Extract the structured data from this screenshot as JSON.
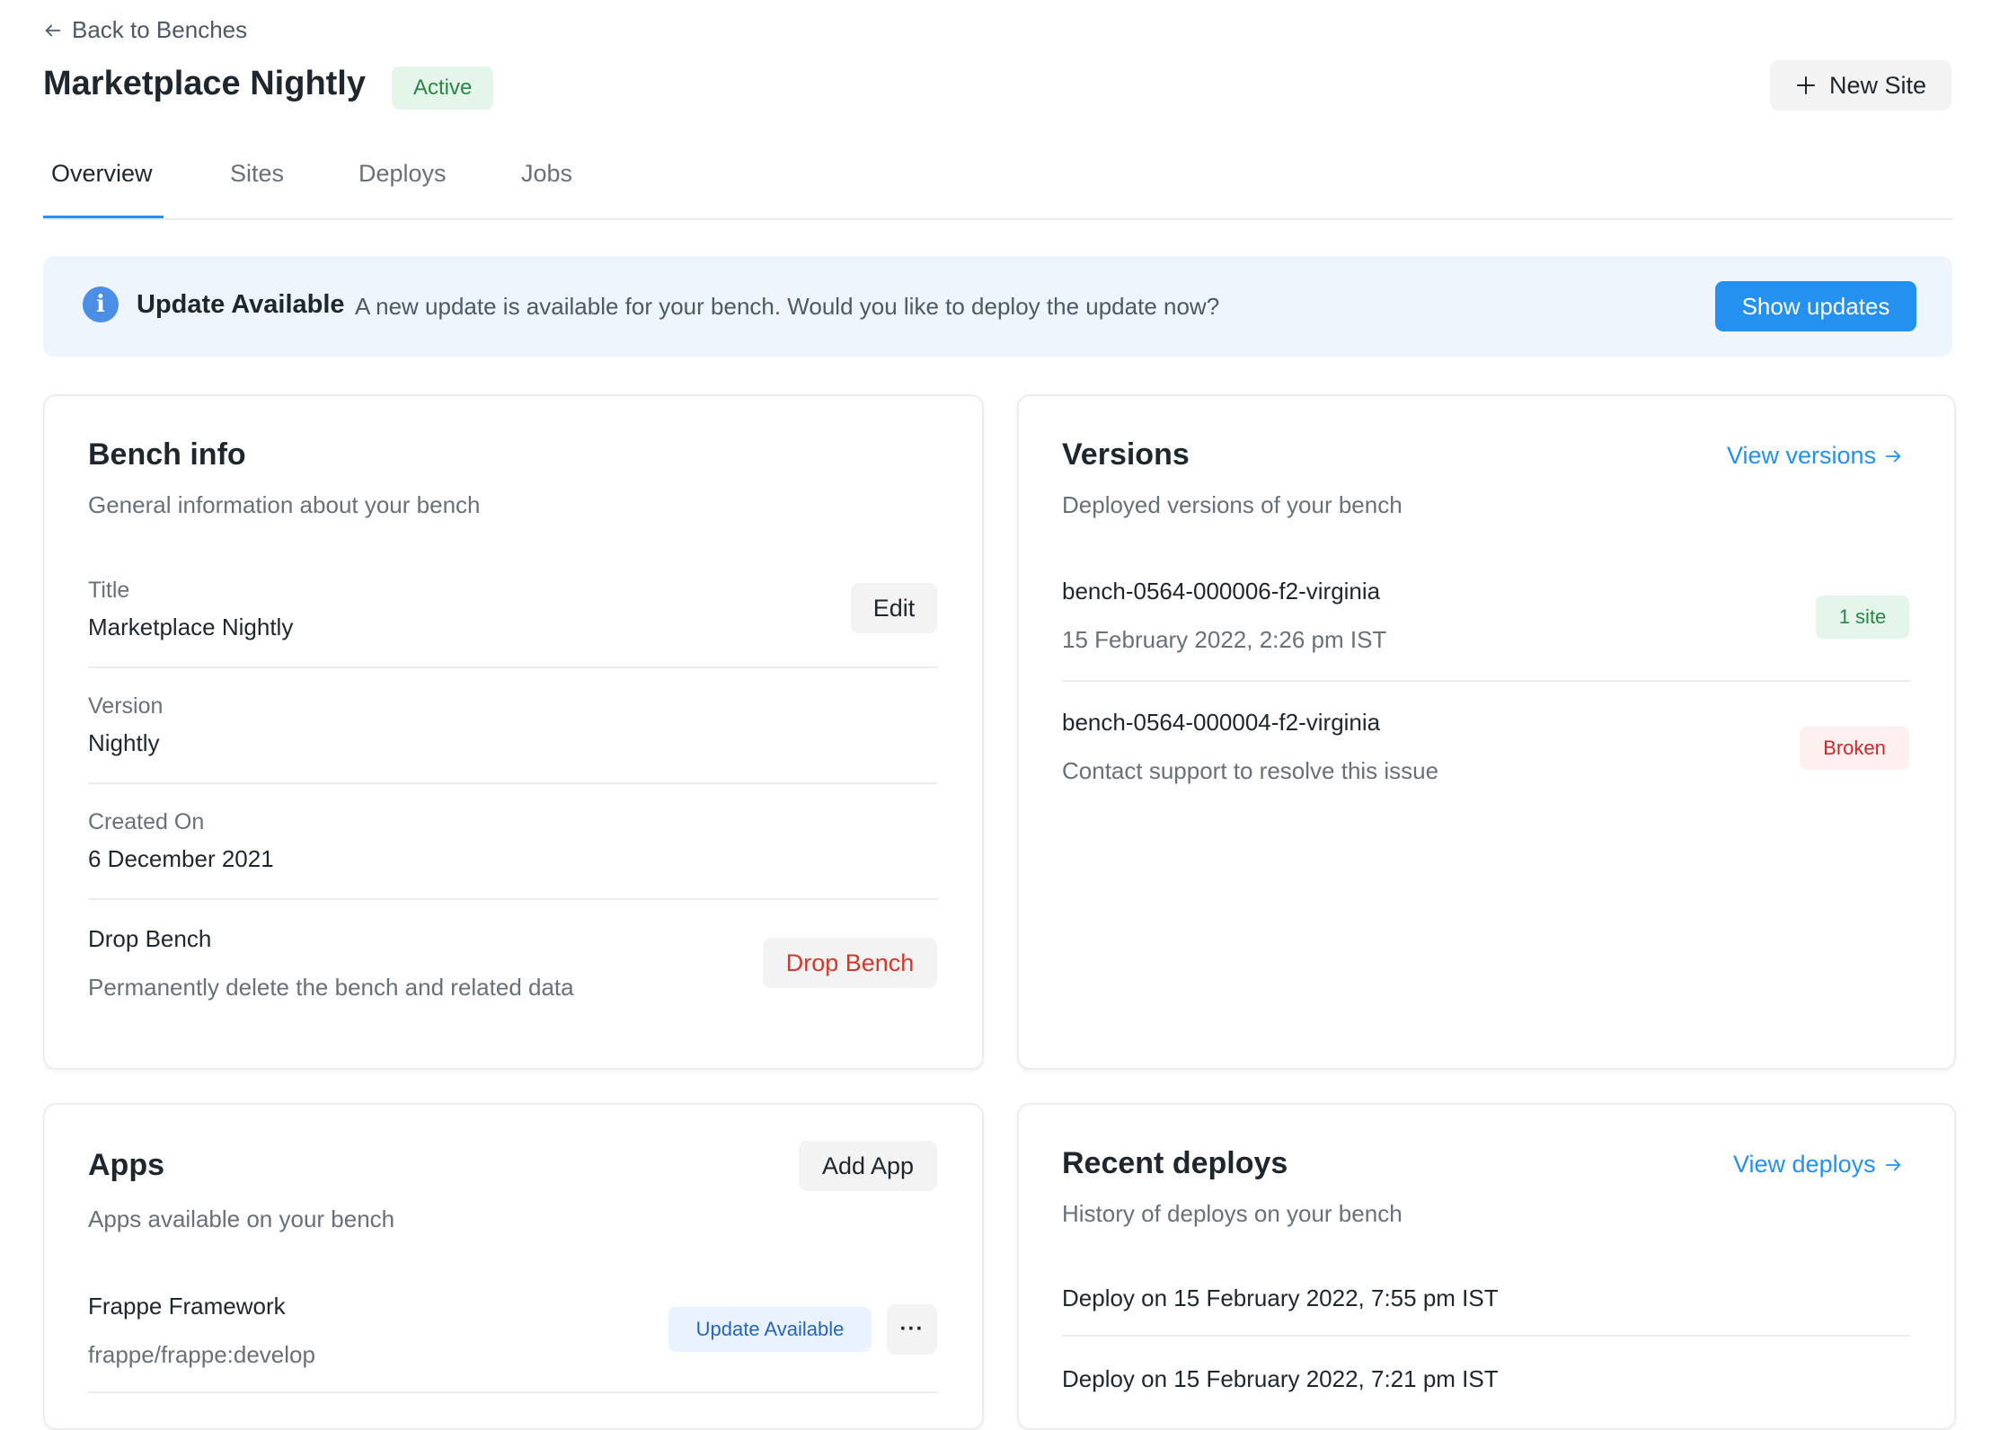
{
  "header": {
    "back_label": "Back to Benches",
    "title": "Marketplace Nightly",
    "status": "Active",
    "new_site_label": "New Site"
  },
  "tabs": [
    {
      "label": "Overview",
      "active": true
    },
    {
      "label": "Sites"
    },
    {
      "label": "Deploys"
    },
    {
      "label": "Jobs"
    }
  ],
  "banner": {
    "title": "Update Available",
    "message": "A new update is available for your bench. Would you like to deploy the update now?",
    "button_label": "Show updates"
  },
  "bench_info": {
    "title": "Bench info",
    "subtitle": "General information about your bench",
    "fields": [
      {
        "label": "Title",
        "value": "Marketplace Nightly"
      },
      {
        "label": "Version",
        "value": "Nightly"
      },
      {
        "label": "Created On",
        "value": "6 December 2021"
      }
    ],
    "edit_label": "Edit",
    "drop": {
      "title": "Drop Bench",
      "description": "Permanently delete the bench and related data",
      "button_label": "Drop Bench"
    }
  },
  "versions": {
    "title": "Versions",
    "subtitle": "Deployed versions of your bench",
    "link_label": "View versions",
    "items": [
      {
        "name": "bench-0564-000006-f2-virginia",
        "detail": "15 February 2022, 2:26 pm IST",
        "badge": "1 site"
      },
      {
        "name": "bench-0564-000004-f2-virginia",
        "detail": "Contact support to resolve this issue",
        "badge": "Broken"
      }
    ]
  },
  "apps": {
    "title": "Apps",
    "subtitle": "Apps available on your bench",
    "add_label": "Add App",
    "items": [
      {
        "name": "Frappe Framework",
        "repo": "frappe/frappe:develop",
        "badge": "Update Available",
        "menu": "···"
      }
    ]
  },
  "recent_deploys": {
    "title": "Recent deploys",
    "subtitle": "History of deploys on your bench",
    "link_label": "View deploys",
    "items": [
      "Deploy on 15 February 2022, 7:55 pm IST",
      "Deploy on 15 February 2022, 7:21 pm IST"
    ]
  },
  "colors": {
    "accent": "#2490ef",
    "success": "#2b8448",
    "danger": "#cc2929",
    "banner_bg": "#eef5fd"
  }
}
